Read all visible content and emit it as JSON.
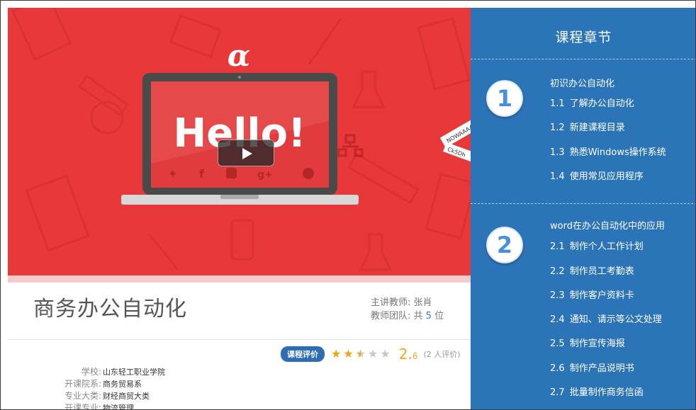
{
  "video": {
    "logo_text": "α",
    "hello_text": "Hello!",
    "tape1": "NOWAAAA",
    "tape2": "Ck5Dh"
  },
  "course": {
    "title": "商务办公自动化",
    "teacher_label": "主讲教师:",
    "teacher_name": "张肖",
    "team_prefix": "教师团队: 共",
    "team_count": "5",
    "team_suffix": "位"
  },
  "rating": {
    "badge": "课程评价",
    "stars": 2.6,
    "score_main": "2.",
    "score_decimal": "6",
    "count": "(2 人评价)"
  },
  "meta": [
    {
      "label": "学校:",
      "value": "山东轻工职业学院"
    },
    {
      "label": "开课院系:",
      "value": "商务贸易系"
    },
    {
      "label": "专业大类:",
      "value": "财经商贸大类"
    },
    {
      "label": "开课专业:",
      "value": "物流管理"
    }
  ],
  "sidebar": {
    "title": "课程章节",
    "chapters": [
      {
        "number": "1",
        "title": "初识办公自动化",
        "lessons": [
          {
            "num": "1.1",
            "title": "了解办公自动化"
          },
          {
            "num": "1.2",
            "title": "新建课程目录"
          },
          {
            "num": "1.3",
            "title": "熟悉Windows操作系统"
          },
          {
            "num": "1.4",
            "title": "使用常见应用程序"
          }
        ]
      },
      {
        "number": "2",
        "title": "word在办公自动化中的应用",
        "lessons": [
          {
            "num": "2.1",
            "title": "制作个人工作计划"
          },
          {
            "num": "2.2",
            "title": "制作员工考勤表"
          },
          {
            "num": "2.3",
            "title": "制作客户资料卡"
          },
          {
            "num": "2.4",
            "title": "通知、请示等公文处理"
          },
          {
            "num": "2.5",
            "title": "制作宣传海报"
          },
          {
            "num": "2.6",
            "title": "制作产品说明书"
          },
          {
            "num": "2.7",
            "title": "批量制作商务信函"
          }
        ]
      }
    ]
  },
  "colors": {
    "video_bg": "#e8383a",
    "sidebar_bg": "#2c74b8",
    "star": "#f0a516",
    "badge": "#2e6db3"
  }
}
